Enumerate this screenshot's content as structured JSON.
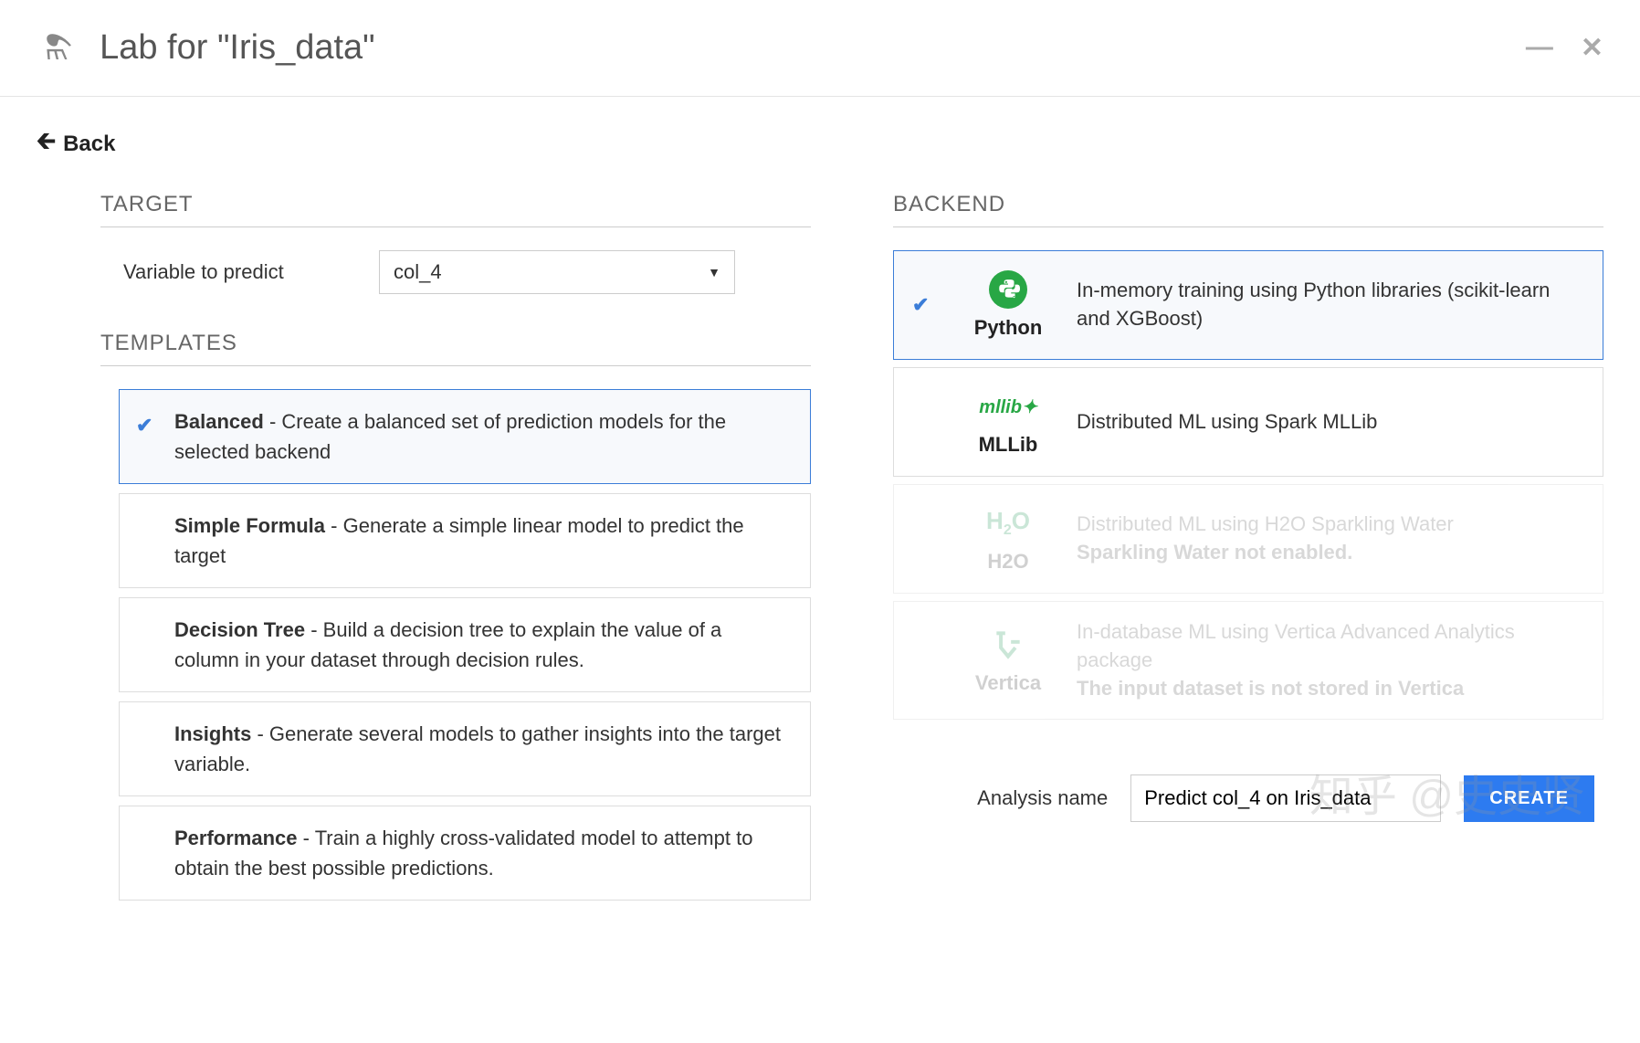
{
  "header": {
    "title": "Lab for \"Iris_data\""
  },
  "back_label": "Back",
  "target": {
    "section_title": "TARGET",
    "variable_label": "Variable to predict",
    "variable_value": "col_4"
  },
  "templates": {
    "section_title": "TEMPLATES",
    "items": [
      {
        "name": "Balanced",
        "desc": "Create a balanced set of prediction models for the selected backend",
        "selected": true
      },
      {
        "name": "Simple Formula",
        "desc": "Generate a simple linear model to predict the target",
        "selected": false
      },
      {
        "name": "Decision Tree",
        "desc": "Build a decision tree to explain the value of a column in your dataset through decision rules.",
        "selected": false
      },
      {
        "name": "Insights",
        "desc": "Generate several models to gather insights into the target variable.",
        "selected": false
      },
      {
        "name": "Performance",
        "desc": "Train a highly cross-validated model to attempt to obtain the best possible predictions.",
        "selected": false
      }
    ]
  },
  "backend": {
    "section_title": "BACKEND",
    "items": [
      {
        "name": "Python",
        "icon": "python-icon",
        "desc": "In-memory training using Python libraries (scikit-learn and XGBoost)",
        "selected": true,
        "disabled": false
      },
      {
        "name": "MLLib",
        "icon": "mllib-icon",
        "desc": "Distributed ML using Spark MLLib",
        "selected": false,
        "disabled": false
      },
      {
        "name": "H2O",
        "icon": "h2o-icon",
        "desc": "Distributed ML using H2O Sparkling Water",
        "warn": "Sparkling Water not enabled.",
        "selected": false,
        "disabled": true
      },
      {
        "name": "Vertica",
        "icon": "vertica-icon",
        "desc": "In-database ML using Vertica Advanced Analytics package",
        "warn": "The input dataset is not stored in Vertica",
        "selected": false,
        "disabled": true
      }
    ]
  },
  "footer": {
    "analysis_label": "Analysis name",
    "analysis_value": "Predict col_4 on Iris_data",
    "create_label": "CREATE"
  },
  "watermark": "知乎 @史史贤"
}
